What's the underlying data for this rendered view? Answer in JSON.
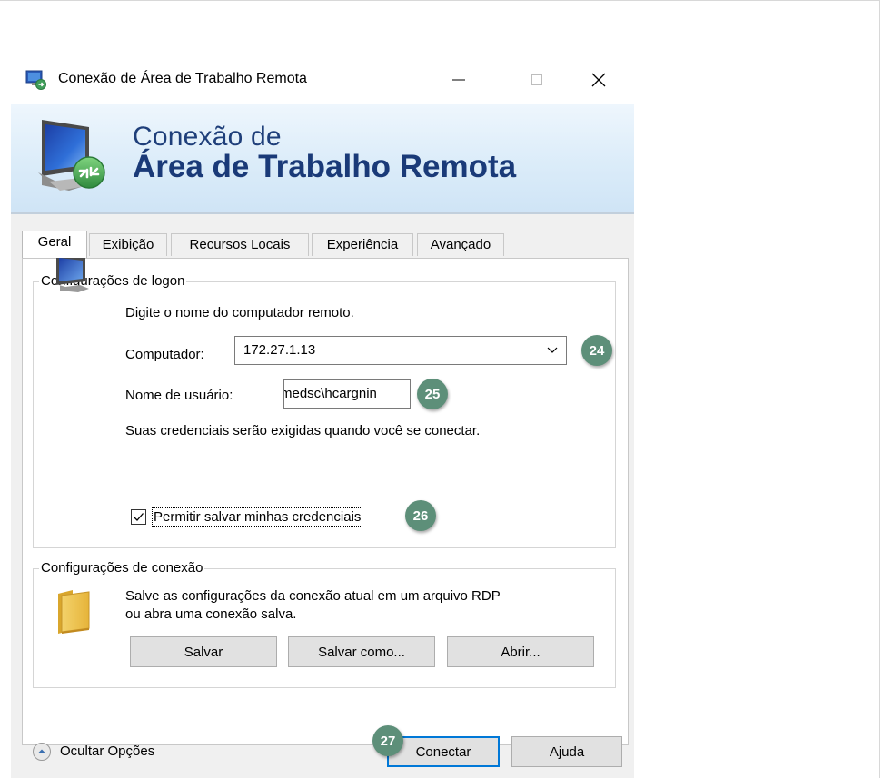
{
  "window": {
    "title": "Conexão de Área de Trabalho Remota",
    "minimize_glyph": "—",
    "maximize_glyph": "☐",
    "close_glyph": "✕"
  },
  "banner": {
    "line1": "Conexão de",
    "line2": "Área de Trabalho Remota"
  },
  "tabs": [
    {
      "label": "Geral",
      "active": true
    },
    {
      "label": "Exibição"
    },
    {
      "label": "Recursos Locais"
    },
    {
      "label": "Experiência"
    },
    {
      "label": "Avançado"
    }
  ],
  "logon": {
    "group_title": "Configurações de logon",
    "prompt": "Digite o nome do computador remoto.",
    "computer_label": "Computador:",
    "computer_value": "172.27.1.13",
    "username_label": "Nome de usuário:",
    "username_value": "medsc\\hcargnin",
    "credentials_note": "Suas credenciais serão exigidas quando você se conectar.",
    "save_credentials_label": "Permitir salvar minhas credenciais",
    "save_credentials_checked": true
  },
  "connection": {
    "group_title": "Configurações de conexão",
    "description_line1": "Salve as configurações da conexão atual em um arquivo RDP",
    "description_line2": "ou abra uma conexão salva.",
    "save_label": "Salvar",
    "save_as_label": "Salvar como...",
    "open_label": "Abrir..."
  },
  "footer": {
    "hide_options_label": "Ocultar Opções",
    "connect_label": "Conectar",
    "help_label": "Ajuda"
  },
  "callouts": {
    "computer": "24",
    "username": "25",
    "save_credentials": "26",
    "connect": "27"
  },
  "colors": {
    "callout": "#5d8f79",
    "accent_border": "#0078d7",
    "banner_title": "#1a3a78"
  },
  "icons": {
    "app": "remote-desktop-icon",
    "banner": "remote-desktop-monitor-icon",
    "computer": "computer-monitor-icon",
    "folder": "folder-icon",
    "dropdown": "chevron-down-icon",
    "toggle": "chevron-up-circle-icon"
  }
}
